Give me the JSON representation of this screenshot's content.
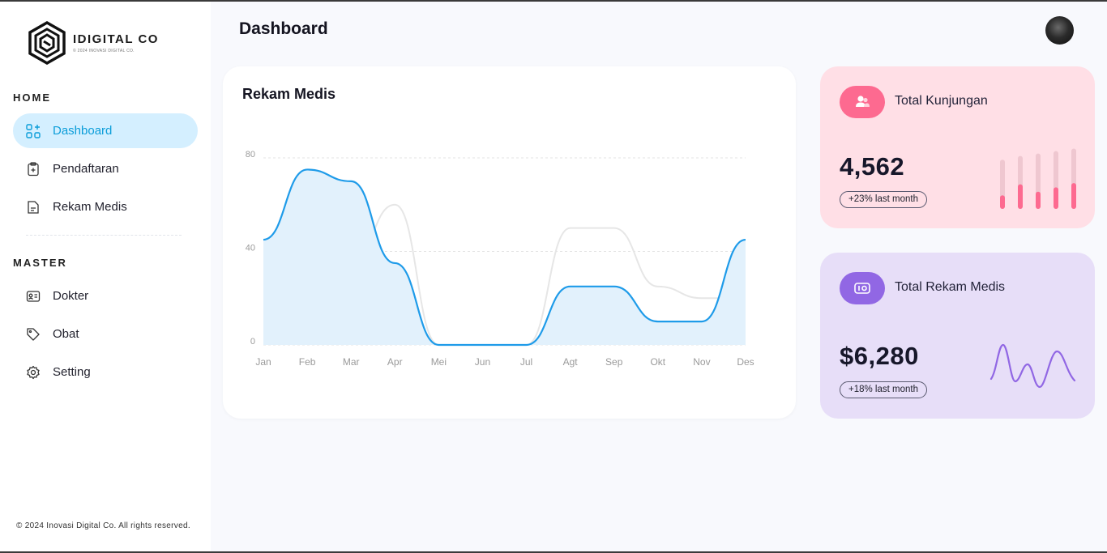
{
  "brand": {
    "name": "IDIGITAL CO",
    "tagline": "© 2024 INOVASI DIGITAL CO."
  },
  "sidebar": {
    "home_label": "HOME",
    "master_label": "MASTER",
    "home_items": [
      {
        "label": "Dashboard",
        "icon": "grid-plus-icon",
        "active": true
      },
      {
        "label": "Pendaftaran",
        "icon": "clipboard-plus-icon",
        "active": false
      },
      {
        "label": "Rekam Medis",
        "icon": "document-icon",
        "active": false
      }
    ],
    "master_items": [
      {
        "label": "Dokter",
        "icon": "id-card-icon"
      },
      {
        "label": "Obat",
        "icon": "pill-icon"
      },
      {
        "label": "Setting",
        "icon": "gear-icon"
      }
    ],
    "footer": "© 2024 Inovasi Digital Co. All rights reserved."
  },
  "header": {
    "title": "Dashboard"
  },
  "chart": {
    "title": "Rekam Medis",
    "accent": "#1e9be9",
    "secondary": "#e6e6e6"
  },
  "chart_data": {
    "type": "area",
    "categories": [
      "Jan",
      "Feb",
      "Mar",
      "Apr",
      "Mei",
      "Jun",
      "Jul",
      "Agt",
      "Sep",
      "Okt",
      "Nov",
      "Des"
    ],
    "ylim": [
      0,
      80
    ],
    "yticks": [
      0,
      40,
      80
    ],
    "grid": true,
    "series": [
      {
        "values": [
          45,
          75,
          70,
          35,
          0,
          0,
          0,
          25,
          25,
          10,
          10,
          45
        ]
      },
      {
        "values": [
          20,
          35,
          35,
          60,
          0,
          0,
          0,
          50,
          50,
          25,
          20,
          20
        ]
      }
    ]
  },
  "stats": {
    "visits": {
      "label": "Total Kunjungan",
      "value": "4,562",
      "badge": "+23% last month",
      "icon": "users-icon",
      "color": "#fd6a90",
      "bars": [
        {
          "total": 1.0,
          "fill": 0.22
        },
        {
          "total": 1.0,
          "fill": 0.4
        },
        {
          "total": 1.0,
          "fill": 0.28
        },
        {
          "total": 1.0,
          "fill": 0.35
        },
        {
          "total": 1.0,
          "fill": 0.42
        }
      ]
    },
    "records": {
      "label": "Total Rekam Medis",
      "value": "$6,280",
      "badge": "+18% last month",
      "icon": "wallet-icon",
      "color": "#9167e4"
    }
  }
}
